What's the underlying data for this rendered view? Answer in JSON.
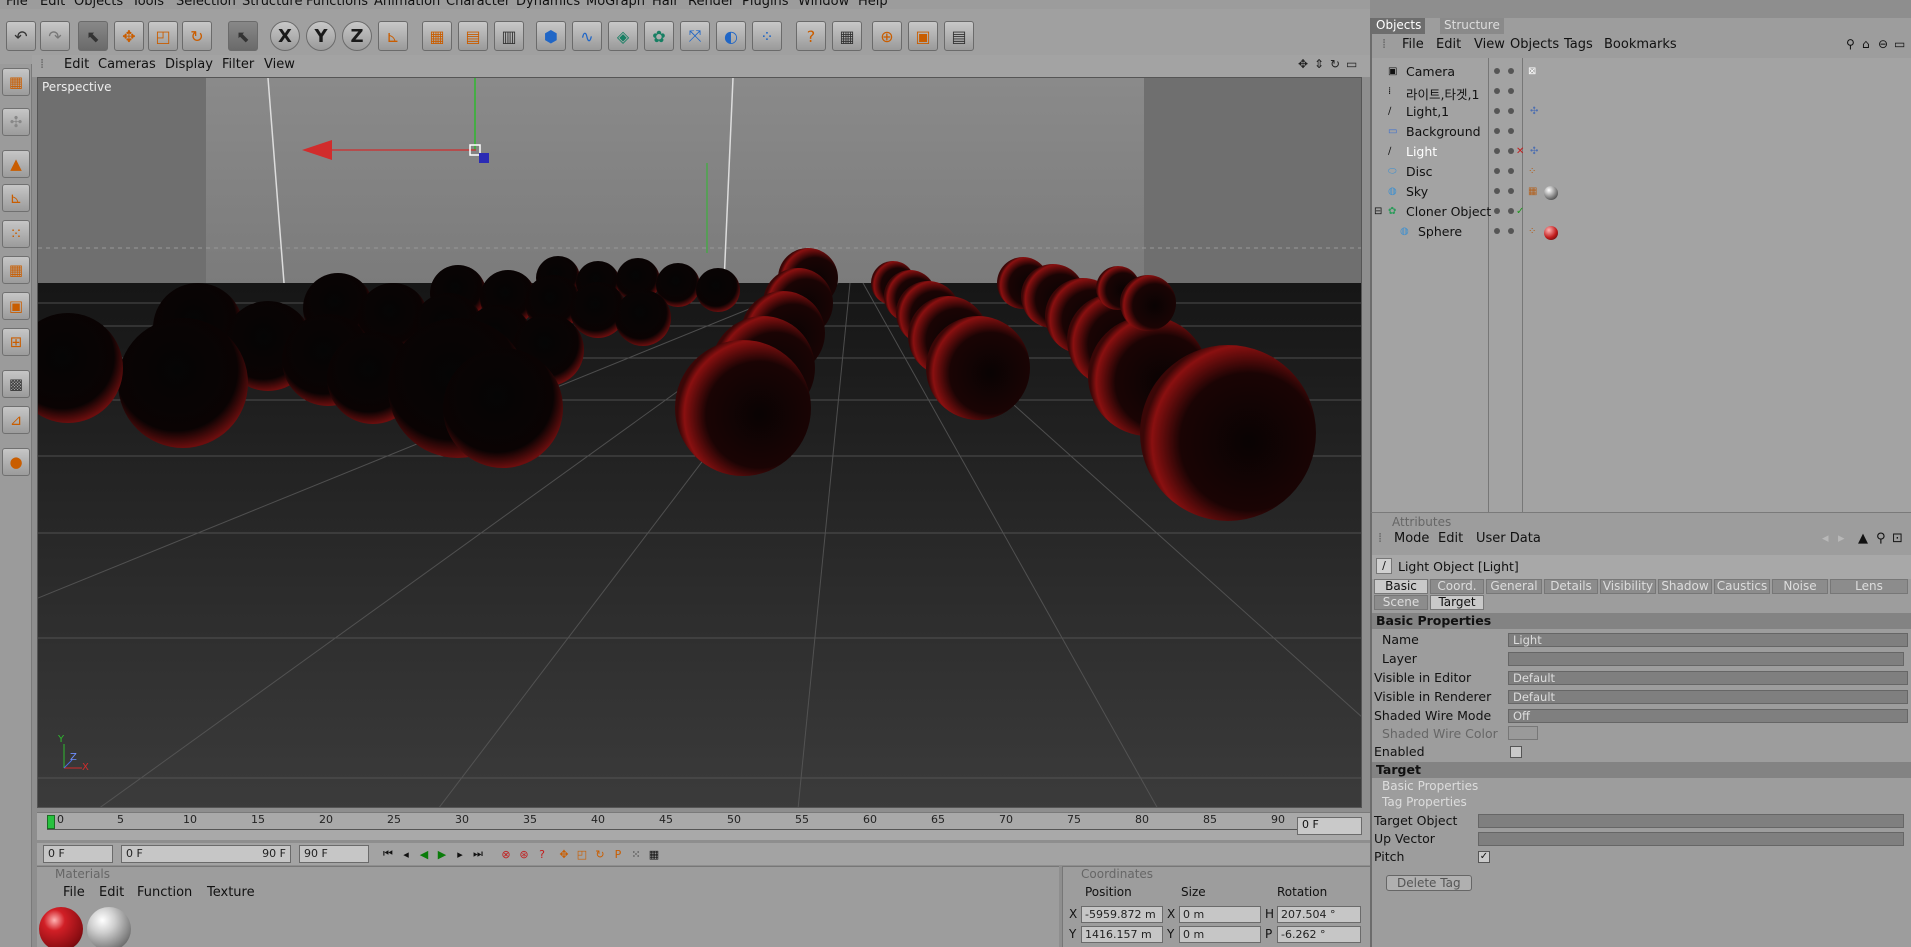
{
  "menu": {
    "file": "File",
    "edit": "Edit",
    "objects": "Objects",
    "tools": "Tools",
    "selection": "Selection",
    "structure": "Structure",
    "functions": "Functions",
    "animation": "Animation",
    "character": "Character",
    "dynamics": "Dynamics",
    "mograph": "MoGraph",
    "hair": "Hair",
    "render": "Render",
    "plugins": "Plugins",
    "window": "Window",
    "help": "Help"
  },
  "toolbar_axes": {
    "x": "X",
    "y": "Y",
    "z": "Z"
  },
  "viewport": {
    "menu": {
      "edit": "Edit",
      "cameras": "Cameras",
      "display": "Display",
      "filter": "Filter",
      "view": "View"
    },
    "label": "Perspective",
    "axis_gizmo": {
      "x": "X",
      "y": "Y",
      "z": "Z"
    }
  },
  "timeline": {
    "ticks": [
      "0",
      "5",
      "10",
      "15",
      "20",
      "25",
      "30",
      "35",
      "40",
      "45",
      "50",
      "55",
      "60",
      "65",
      "70",
      "75",
      "80",
      "85",
      "90"
    ],
    "current_frame": "0 F"
  },
  "transport": {
    "start_frame": "0 F",
    "slider_value": "0 F",
    "slider_end": "90 F",
    "end_frame": "90 F"
  },
  "materials": {
    "title": "Materials",
    "menu": {
      "file": "File",
      "edit": "Edit",
      "function": "Function",
      "texture": "Texture"
    },
    "swatches": [
      {
        "color": "#b3151b"
      },
      {
        "color": "#a6a6a6"
      }
    ]
  },
  "coordinates": {
    "title": "Coordinates",
    "columns": {
      "position": "Position",
      "size": "Size",
      "rotation": "Rotation"
    },
    "rows": [
      {
        "axis": "X",
        "position": "-5959.872 m",
        "size_axis": "X",
        "size": "0 m",
        "rot_axis": "H",
        "rotation": "207.504 °"
      },
      {
        "axis": "Y",
        "position": "1416.157 m",
        "size_axis": "Y",
        "size": "0 m",
        "rot_axis": "P",
        "rotation": "-6.262 °"
      }
    ]
  },
  "objects_panel": {
    "tabs": {
      "objects": "Objects",
      "structure": "Structure"
    },
    "menu": {
      "file": "File",
      "edit": "Edit",
      "view": "View",
      "objects": "Objects",
      "tags": "Tags",
      "bookmarks": "Bookmarks"
    },
    "items": [
      {
        "name": "Camera"
      },
      {
        "name": "라이트,타겟,1"
      },
      {
        "name": "Light,1"
      },
      {
        "name": "Background"
      },
      {
        "name": "Light"
      },
      {
        "name": "Disc"
      },
      {
        "name": "Sky"
      },
      {
        "name": "Cloner Object"
      },
      {
        "name": "Sphere"
      }
    ]
  },
  "attributes_panel": {
    "title": "Attributes",
    "menu": {
      "mode": "Mode",
      "edit": "Edit",
      "user_data": "User Data"
    },
    "object_title": "Light Object [Light]",
    "tabs_row1": [
      "Basic",
      "Coord.",
      "General",
      "Details",
      "Visibility",
      "Shadow",
      "Caustics",
      "Noise",
      "Lens"
    ],
    "tabs_row2": [
      "Scene",
      "Target"
    ],
    "basic_header": "Basic Properties",
    "props": {
      "name_label": "Name",
      "name_value": "Light",
      "layer_label": "Layer",
      "vis_editor_label": "Visible in Editor",
      "vis_editor_value": "Default",
      "vis_render_label": "Visible in Renderer",
      "vis_render_value": "Default",
      "shaded_wire_label": "Shaded Wire Mode",
      "shaded_wire_value": "Off",
      "shaded_wire_color_label": "Shaded Wire Color",
      "enabled_label": "Enabled"
    },
    "target_header": "Target",
    "target_sub1": "Basic Properties",
    "target_sub2": "Tag Properties",
    "target_props": {
      "target_object_label": "Target Object",
      "up_vector_label": "Up Vector",
      "pitch_label": "Pitch"
    },
    "delete_tag": "Delete Tag"
  }
}
